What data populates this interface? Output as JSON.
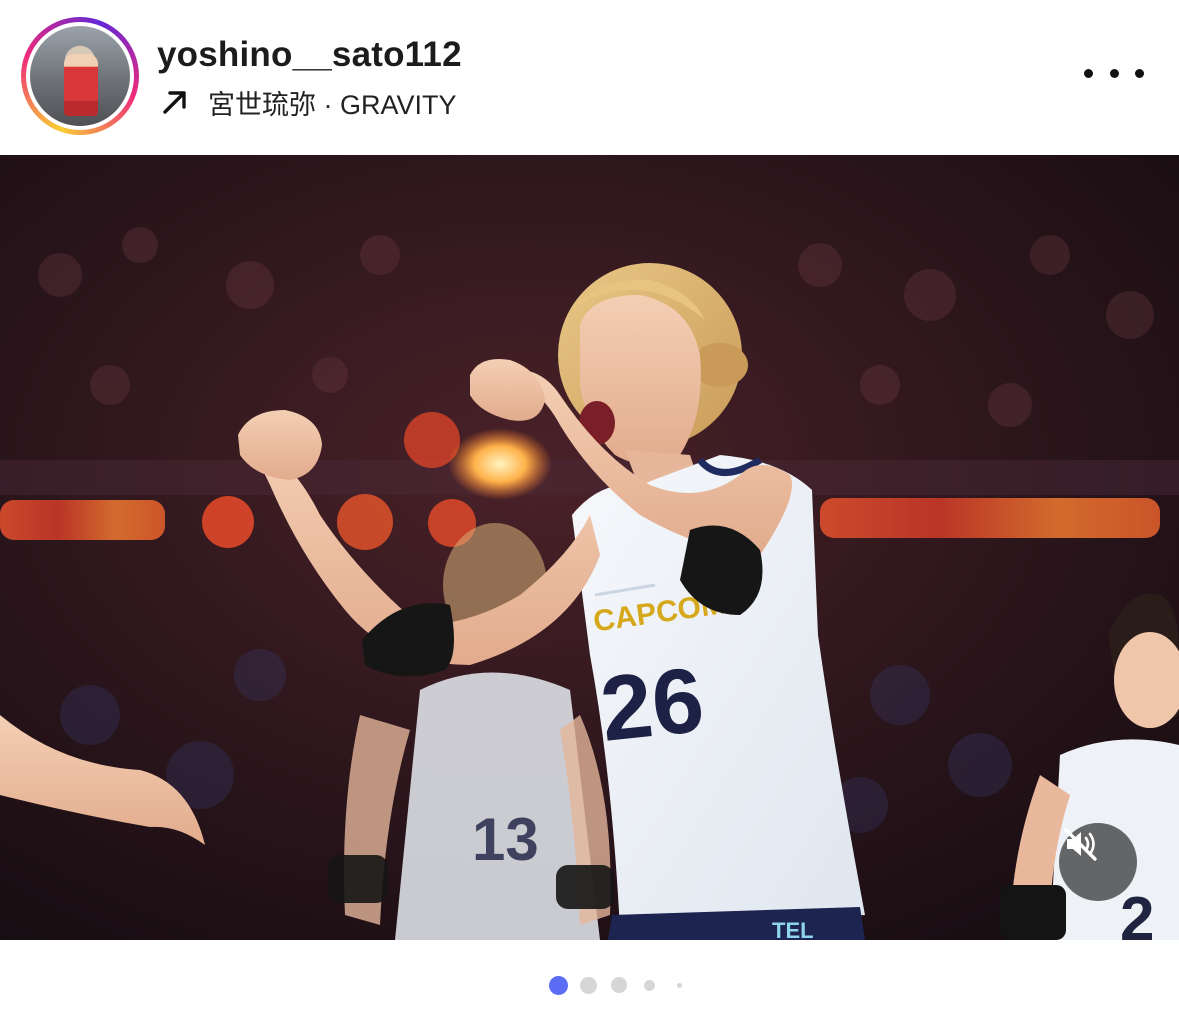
{
  "post": {
    "username": "yoshino__sato112",
    "location_line": "宮世琉弥 · GRAVITY",
    "more_icon": "more-horizontal-icon",
    "arrow_icon": "arrow-up-right-icon",
    "mute_icon": "speaker-muted-icon"
  },
  "media": {
    "jersey_main": "26",
    "jersey_back": "13",
    "jersey_right": "2",
    "sponsor": "CAPCOM",
    "shorts_text": "TEL"
  },
  "carousel": {
    "active_index": 0,
    "count": 5,
    "active_color": "#5b6cf5",
    "inactive_color": "#d6d6d6"
  }
}
